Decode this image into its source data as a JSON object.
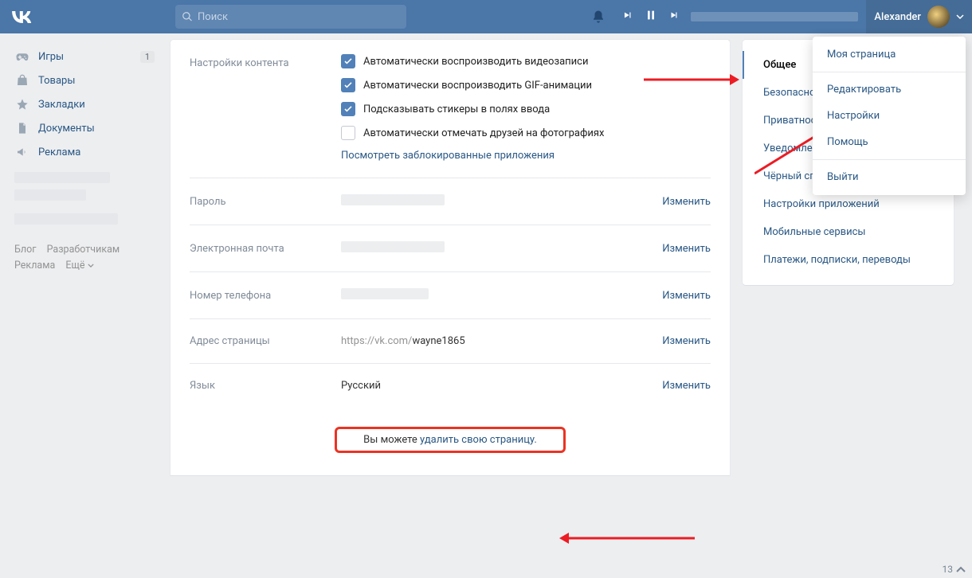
{
  "header": {
    "search_placeholder": "Поиск",
    "username": "Alexander"
  },
  "sidebar": {
    "items": [
      {
        "label": "Игры",
        "badge": "1"
      },
      {
        "label": "Товары"
      },
      {
        "label": "Закладки"
      },
      {
        "label": "Документы"
      },
      {
        "label": "Реклама"
      }
    ]
  },
  "footer": {
    "blog": "Блог",
    "dev": "Разработчикам",
    "ads": "Реклама",
    "more": "Ещё"
  },
  "settings": {
    "content": {
      "label": "Настройки контента",
      "auto_video": "Автоматически воспроизводить видеозаписи",
      "auto_gif": "Автоматически воспроизводить GIF-анимации",
      "stickers": "Подсказывать стикеры в полях ввода",
      "auto_tag": "Автоматически отмечать друзей на фотографиях",
      "blocked_apps": "Посмотреть заблокированные приложения"
    },
    "password": {
      "label": "Пароль",
      "action": "Изменить"
    },
    "email": {
      "label": "Электронная почта",
      "action": "Изменить"
    },
    "phone": {
      "label": "Номер телефона",
      "action": "Изменить"
    },
    "address": {
      "label": "Адрес страницы",
      "prefix": "https://vk.com/",
      "value": "wayne1865",
      "action": "Изменить"
    },
    "lang": {
      "label": "Язык",
      "value": "Русский",
      "action": "Изменить"
    },
    "delete": {
      "prefix": "Вы можете ",
      "link": "удалить свою страницу."
    }
  },
  "rpanel": {
    "tabs": [
      "Общее",
      "Безопасность",
      "Приватность",
      "Уведомления",
      "Чёрный список",
      "Настройки приложений",
      "Мобильные сервисы",
      "Платежи, подписки, переводы"
    ]
  },
  "dropdown": {
    "my_page": "Моя страница",
    "edit": "Редактировать",
    "settings": "Настройки",
    "help": "Помощь",
    "exit": "Выйти"
  },
  "counter": "13"
}
